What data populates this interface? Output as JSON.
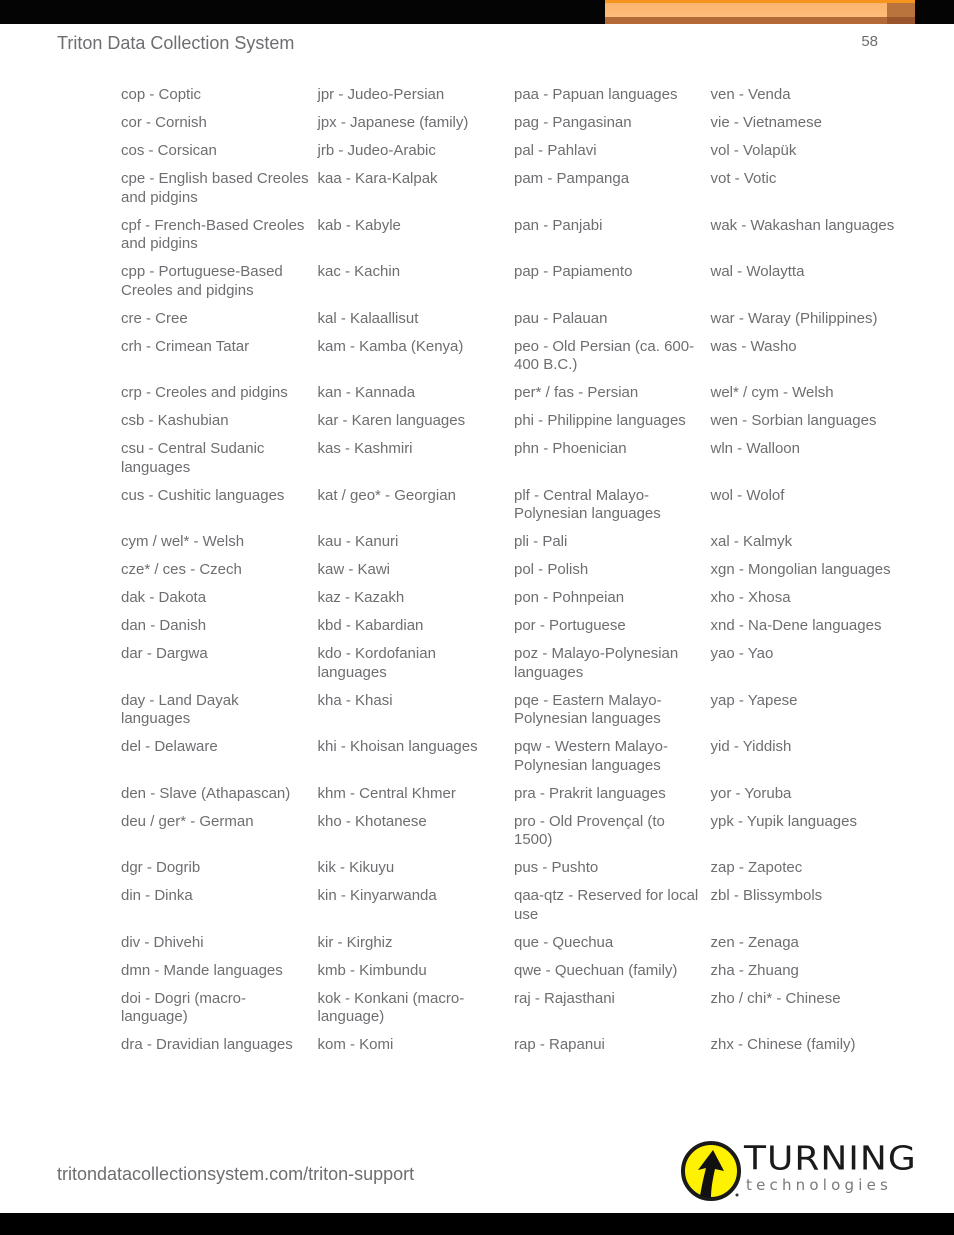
{
  "header": {
    "title": "Triton Data Collection System",
    "page_number": "58"
  },
  "languages": {
    "rows": [
      [
        "cop - Coptic",
        "jpr - Judeo-Persian",
        "paa - Papuan languages",
        "ven - Venda"
      ],
      [
        "cor - Cornish",
        "jpx - Japanese (family)",
        "pag - Pangasinan",
        "vie - Vietnamese"
      ],
      [
        "cos - Corsican",
        "jrb - Judeo-Arabic",
        "pal - Pahlavi",
        "vol - Volapük"
      ],
      [
        "cpe - English based Creoles and pidgins",
        "kaa - Kara-Kalpak",
        "pam - Pampanga",
        "vot - Votic"
      ],
      [
        "cpf - French-Based Creoles and pidgins",
        "kab - Kabyle",
        "pan - Panjabi",
        "wak - Wakashan languages"
      ],
      [
        "cpp - Portuguese-Based Creoles and pidgins",
        "kac - Kachin",
        "pap - Papiamento",
        "wal - Wolaytta"
      ],
      [
        "cre - Cree",
        "kal - Kalaallisut",
        "pau - Palauan",
        "war - Waray (Philippines)"
      ],
      [
        "crh - Crimean Tatar",
        "kam - Kamba (Kenya)",
        "peo - Old Persian (ca. 600-400 B.C.)",
        "was - Washo"
      ],
      [
        "crp - Creoles and pidgins",
        "kan - Kannada",
        "per* / fas - Persian",
        "wel* / cym - Welsh"
      ],
      [
        "csb - Kashubian",
        "kar - Karen languages",
        "phi - Philippine languages",
        "wen - Sorbian languages"
      ],
      [
        "csu - Central Sudanic languages",
        "kas - Kashmiri",
        "phn - Phoenician",
        "wln - Walloon"
      ],
      [
        "cus - Cushitic languages",
        "kat / geo* - Georgian",
        "plf - Central Malayo-Polynesian languages",
        "wol - Wolof"
      ],
      [
        "cym / wel* - Welsh",
        "kau - Kanuri",
        "pli - Pali",
        "xal - Kalmyk"
      ],
      [
        "cze* / ces - Czech",
        "kaw - Kawi",
        "pol - Polish",
        "xgn - Mongolian languages"
      ],
      [
        "dak - Dakota",
        "kaz - Kazakh",
        "pon - Pohnpeian",
        "xho - Xhosa"
      ],
      [
        "dan - Danish",
        "kbd - Kabardian",
        "por - Portuguese",
        "xnd - Na-Dene languages"
      ],
      [
        "dar - Dargwa",
        "kdo - Kordofanian languages",
        "poz - Malayo-Polynesian languages",
        "yao - Yao"
      ],
      [
        "day - Land Dayak languages",
        "kha - Khasi",
        "pqe - Eastern Malayo-Polynesian languages",
        "yap - Yapese"
      ],
      [
        "del - Delaware",
        "khi - Khoisan languages",
        "pqw - Western Malayo-Polynesian languages",
        "yid - Yiddish"
      ],
      [
        "den - Slave (Athapascan)",
        "khm - Central Khmer",
        "pra - Prakrit languages",
        "yor - Yoruba"
      ],
      [
        "deu / ger* - German",
        "kho - Khotanese",
        "pro - Old Provençal (to 1500)",
        "ypk - Yupik languages"
      ],
      [
        "dgr - Dogrib",
        "kik - Kikuyu",
        "pus - Pushto",
        "zap - Zapotec"
      ],
      [
        "din - Dinka",
        "kin - Kinyarwanda",
        "qaa-qtz - Reserved for local use",
        "zbl - Blissymbols"
      ],
      [
        "div - Dhivehi",
        "kir - Kirghiz",
        "que - Quechua",
        "zen - Zenaga"
      ],
      [
        "dmn - Mande languages",
        "kmb - Kimbundu",
        "qwe - Quechuan (family)",
        "zha - Zhuang"
      ],
      [
        "doi - Dogri (macro-language)",
        "kok - Konkani (macro-language)",
        "raj - Rajasthani",
        "zho / chi* - Chinese"
      ],
      [
        "dra - Dravidian languages",
        "kom - Komi",
        "rap - Rapanui",
        "zhx - Chinese (family)"
      ]
    ]
  },
  "footer": {
    "url": "tritondatacollectionsystem.com/triton-support",
    "logo_word": "TURNING",
    "logo_sub": "technologies",
    "logo_icon": "upward-arrow-icon"
  },
  "colors": {
    "text": "#6d6e71",
    "banner_orange": "#f7941d",
    "logo_yellow": "#fff200"
  }
}
